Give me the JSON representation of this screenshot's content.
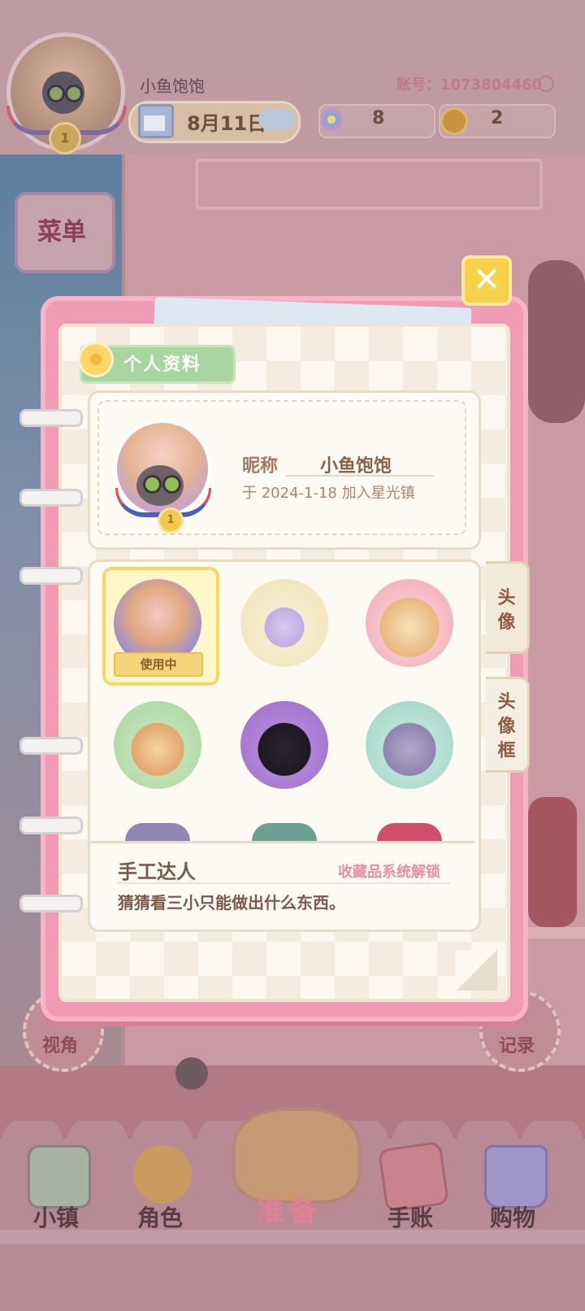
{
  "header": {
    "nickname": "小鱼饱饱",
    "account": "账号：1073804460",
    "date": "8月11日",
    "flowers": "8",
    "coins": "2"
  },
  "menu_label": "菜单",
  "background_buttons": {
    "left_label": "视角",
    "right_label": "记录"
  },
  "dialog": {
    "close_label": "✕",
    "section_title": "个人资料",
    "profile": {
      "nickname_label": "昵称",
      "nickname_value": "小鱼饱饱",
      "join_text": "于 2024-1-18 加入星光镇"
    },
    "tabs": [
      {
        "label": "头像"
      },
      {
        "label": "头像框"
      }
    ],
    "avatars": [
      {
        "icon": "raccoon-group-avatar",
        "in_use": true,
        "badge": "使用中"
      },
      {
        "icon": "magic-top-hat-avatar",
        "in_use": false
      },
      {
        "icon": "shiba-dog-avatar",
        "in_use": false
      },
      {
        "icon": "beagle-lollipop-avatar",
        "in_use": false
      },
      {
        "icon": "black-cat-avatar",
        "in_use": false
      },
      {
        "icon": "grey-cat-octopus-avatar",
        "in_use": false
      }
    ],
    "description": {
      "title": "手工达人",
      "unlock": "收藏品系统解锁",
      "text": "猜猜看三小只能做出什么东西。"
    }
  },
  "nav": {
    "items": [
      {
        "label": "小镇",
        "icon": "town-map-icon"
      },
      {
        "label": "角色",
        "icon": "character-icon"
      },
      {
        "label": "准备",
        "icon": "prepare-basket-icon"
      },
      {
        "label": "手账",
        "icon": "journal-icon"
      },
      {
        "label": "购物",
        "icon": "shopping-bag-icon"
      }
    ]
  },
  "colors": {
    "dialog_pink": "#ee9bb3",
    "section_green": "#a9d6a0",
    "in_use_yellow": "#f7d867",
    "close_yellow": "#f6d24a",
    "unlock_pink": "#ea8ea2"
  }
}
